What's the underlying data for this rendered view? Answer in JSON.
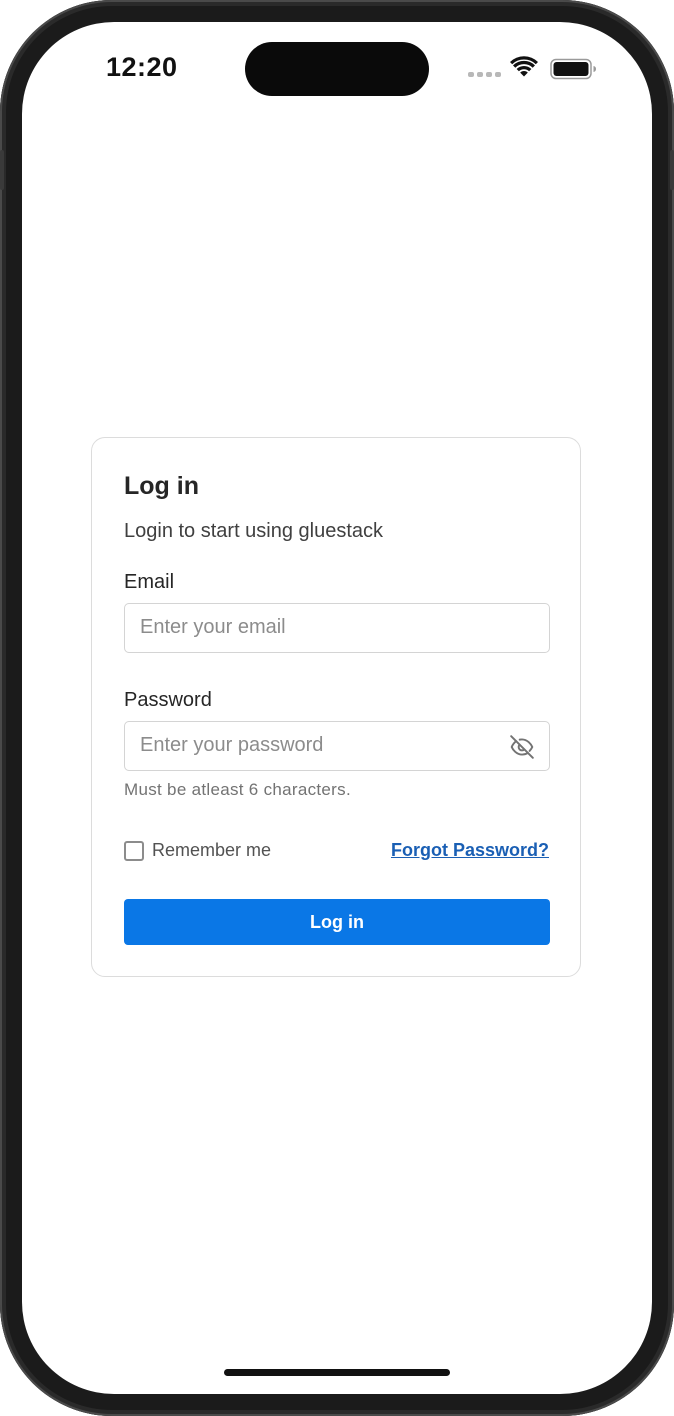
{
  "status_bar": {
    "time": "12:20"
  },
  "login_card": {
    "title": "Log in",
    "subtitle": "Login to start using gluestack",
    "email": {
      "label": "Email",
      "placeholder": "Enter your email",
      "value": ""
    },
    "password": {
      "label": "Password",
      "placeholder": "Enter your password",
      "value": "",
      "helper": "Must be atleast 6 characters.",
      "visibility_icon": "eye-off-icon"
    },
    "remember_me": {
      "label": "Remember me",
      "checked": false
    },
    "forgot_password_label": "Forgot Password?",
    "submit_label": "Log in"
  },
  "colors": {
    "primary": "#0a77e6",
    "link": "#1a5fb4",
    "text": "#262626",
    "border": "#d4d4d4"
  }
}
